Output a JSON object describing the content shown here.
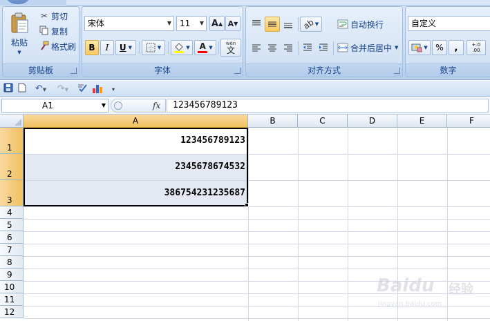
{
  "ribbon": {
    "clipboard": {
      "label": "剪贴板",
      "paste": "粘贴",
      "cut": "剪切",
      "copy": "复制",
      "format_painter": "格式刷"
    },
    "font": {
      "label": "字体",
      "font_name": "宋体",
      "font_size": "11",
      "grow": "A",
      "shrink": "A",
      "bold": "B",
      "italic": "I",
      "underline": "U",
      "phonetic": "wén",
      "phonetic_char": "文"
    },
    "alignment": {
      "label": "对齐方式",
      "wrap_text": "自动换行",
      "merge_center": "合并后居中"
    },
    "number": {
      "label": "数字",
      "format": "自定义",
      "percent": "%",
      "comma": ",",
      "increase_decimal": "+.0 .00"
    }
  },
  "formula_bar": {
    "name_box": "A1",
    "fx": "fx",
    "content": "123456789123"
  },
  "sheet": {
    "columns": [
      "A",
      "B",
      "C",
      "D",
      "E",
      "F"
    ],
    "rows": [
      "1",
      "2",
      "3",
      "4",
      "5",
      "6",
      "7",
      "8",
      "9",
      "10",
      "11",
      "12"
    ],
    "cells": {
      "A1": "123456789123",
      "A2": "2345678674532",
      "A3": "386754231235687"
    },
    "selected_range": "A1:A3"
  },
  "watermark": {
    "brand": "Baidu",
    "cn": "经验",
    "url": "jingyan.baidu.com"
  },
  "colors": {
    "ribbon_bg": "#c5d9f1",
    "header_selected": "#f1c15f",
    "selection_fill": "#e4e8f3",
    "text_blue": "#15428b"
  }
}
